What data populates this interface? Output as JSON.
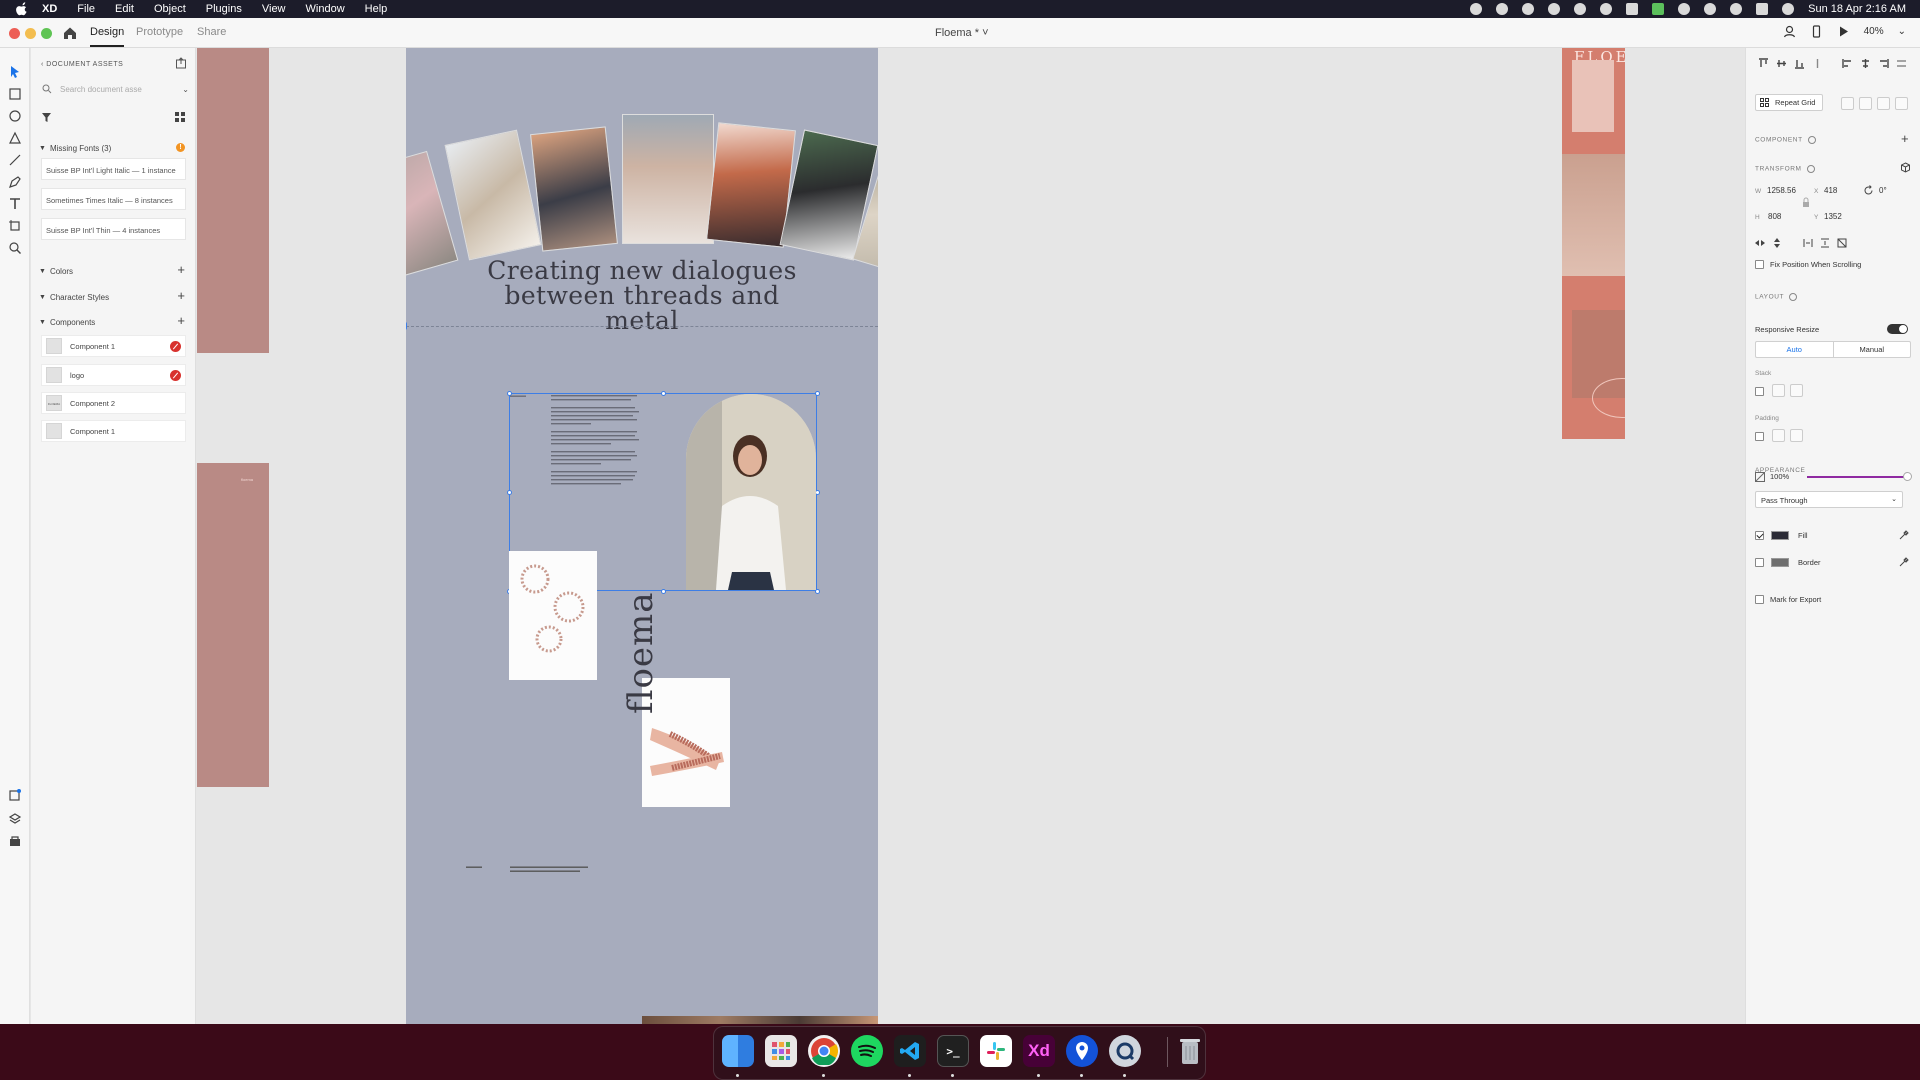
{
  "menubar": {
    "app_name": "XD",
    "menus": [
      "File",
      "Edit",
      "Object",
      "Plugins",
      "View",
      "Window",
      "Help"
    ],
    "clock": "Sun 18 Apr  2:16 AM"
  },
  "titlebar": {
    "tabs": [
      "Design",
      "Prototype",
      "Share"
    ],
    "active_tab": "Design",
    "document_title": "Floema * ˅",
    "zoom": "40%"
  },
  "assets": {
    "header": "DOCUMENT ASSETS",
    "search_placeholder": "Search document asse",
    "missing_fonts_label": "Missing Fonts (3)",
    "missing_fonts_badge": "!",
    "missing_fonts": [
      "Suisse BP Int'l Light Italic — 1 instance",
      "Sometimes Times Italic — 8 instances",
      "Suisse BP Int'l Thin — 4 instances"
    ],
    "colors_label": "Colors",
    "char_styles_label": "Character Styles",
    "components_label": "Components",
    "components": [
      {
        "name": "Component 1",
        "thumb": "",
        "unlinked": true
      },
      {
        "name": "logo",
        "thumb": "",
        "unlinked": true
      },
      {
        "name": "Component 2",
        "thumb": "FLOEMA",
        "unlinked": false
      },
      {
        "name": "Component 1",
        "thumb": "",
        "unlinked": false
      }
    ]
  },
  "canvas": {
    "headline_line1": "Creating new dialogues",
    "headline_line2": "between threads and metal",
    "vertical_word": "floema",
    "sidebox_label": "floema",
    "right_artboard_text": "FLOE"
  },
  "inspector": {
    "repeat_grid_label": "Repeat Grid",
    "component_label": "COMPONENT",
    "transform_label": "TRANSFORM",
    "w_label": "W",
    "w_value": "1258.56",
    "x_label": "X",
    "x_value": "418",
    "h_label": "H",
    "h_value": "808",
    "y_label": "Y",
    "y_value": "1352",
    "rotation": "0°",
    "fix_position_label": "Fix Position When Scrolling",
    "layout_label": "LAYOUT",
    "responsive_resize_label": "Responsive Resize",
    "responsive_resize_on": true,
    "resize_modes": [
      "Auto",
      "Manual"
    ],
    "active_resize_mode": "Auto",
    "stack_label": "Stack",
    "padding_label": "Padding",
    "appearance_label": "APPEARANCE",
    "opacity": "100%",
    "blend_mode": "Pass Through",
    "fill_label": "Fill",
    "fill_checked": true,
    "fill_color": "#2b2b36",
    "border_label": "Border",
    "border_checked": false,
    "border_color": "#6e6e6e",
    "mark_export_label": "Mark for Export"
  },
  "dock": {
    "apps": [
      "finder-icon",
      "launchpad-icon",
      "chrome-icon",
      "spotify-icon",
      "vscode-icon",
      "terminal-icon",
      "slack-icon",
      "xd-icon",
      "maps-pin-icon",
      "quicktime-icon",
      "trash-icon"
    ]
  },
  "colors": {
    "accent_blue": "#3d7ee6",
    "artboard_bg": "#a7acbd",
    "sidebox": "#b98a85",
    "opacity_slider": "#8f2aa1"
  }
}
